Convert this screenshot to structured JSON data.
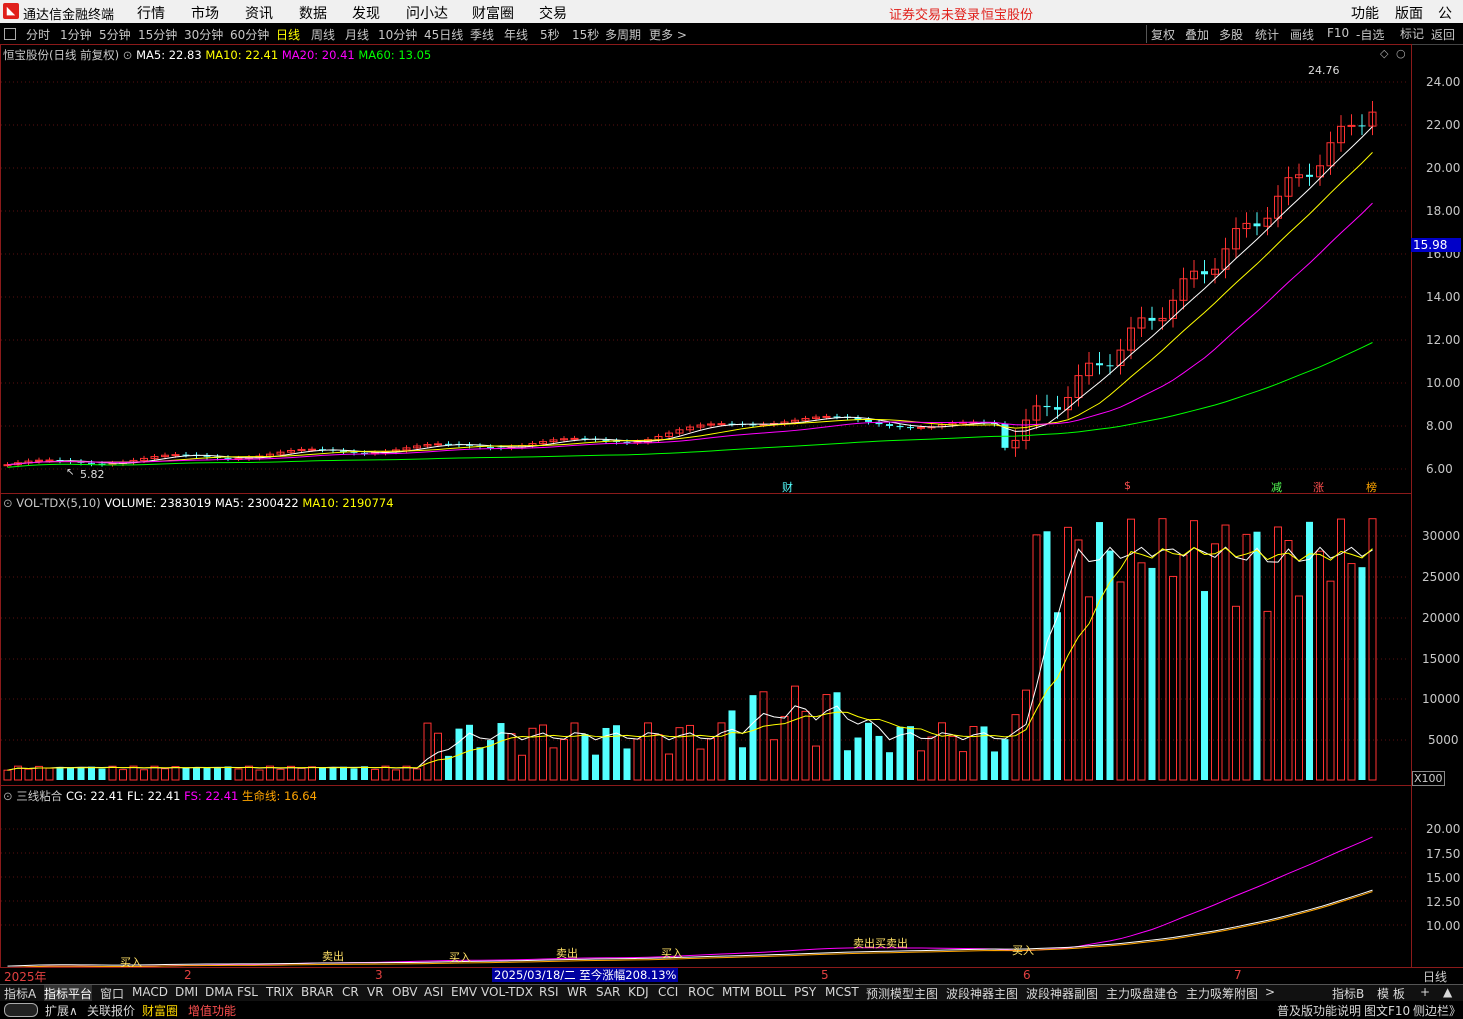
{
  "app": {
    "title": "通达信金融终端",
    "logo_icon": "tdx-logo-icon",
    "warn_login": "证券交易未登录",
    "warn_stock": "恒宝股份"
  },
  "menu": [
    "行情",
    "市场",
    "资讯",
    "数据",
    "发现",
    "问小达",
    "财富圈",
    "交易"
  ],
  "title_right": [
    "功能",
    "版面",
    "公式"
  ],
  "periods": [
    "分时",
    "1分钟",
    "5分钟",
    "15分钟",
    "30分钟",
    "60分钟",
    "日线",
    "周线",
    "月线",
    "10分钟",
    "45日线",
    "季线",
    "年线",
    "5秒",
    "15秒",
    "多周期",
    "更多 >"
  ],
  "active_period": "日线",
  "right_tools": [
    "复权",
    "叠加",
    "多股",
    "统计",
    "画线",
    "F10",
    "-自选",
    "返回"
  ],
  "main": {
    "stock": "恒宝股份(日线 前复权)",
    "ma5": "MA5: 22.83",
    "ma10": "MA10: 22.41",
    "ma20": "MA20: 20.41",
    "ma60": "MA60: 13.05",
    "high_label": "24.76",
    "low_label": "5.82",
    "current_price": "15.98",
    "y_labels": [
      "24.00",
      "22.00",
      "20.00",
      "18.00",
      "16.00",
      "14.00",
      "12.00",
      "10.00",
      "8.00",
      "6.00"
    ],
    "markers": [
      "财",
      "$",
      "减",
      "涨",
      "榜"
    ]
  },
  "volume": {
    "title": "VOL-TDX(5,10)",
    "volume": "VOLUME: 2383019",
    "ma5": "MA5: 2300422",
    "ma10": "MA10: 2190774",
    "y_labels": [
      "30000",
      "25000",
      "20000",
      "15000",
      "10000",
      "5000"
    ],
    "unit": "X100"
  },
  "indicator": {
    "title": "三线粘合",
    "cg": "CG: 22.41",
    "fl": "FL: 22.41",
    "fs": "FS: 22.41",
    "life": "生命线: 16.64",
    "y_labels": [
      "20.00",
      "17.50",
      "15.00",
      "12.50",
      "10.00"
    ],
    "signals": [
      "买入",
      "卖出",
      "买入",
      "卖出",
      "买入",
      "卖出买卖出",
      "买入"
    ]
  },
  "xaxis": {
    "labels": [
      "2025年",
      "2",
      "3",
      "5",
      "6",
      "7"
    ],
    "tooltip": "2025/03/18/二  至今涨幅208.13%",
    "right": "日线"
  },
  "bottom_tabs": [
    "指标A",
    "指标平台",
    "窗口",
    "MACD",
    "DMI",
    "DMA",
    "FSL",
    "TRIX",
    "BRAR",
    "CR",
    "VR",
    "OBV",
    "ASI",
    "EMV",
    "VOL-TDX",
    "RSI",
    "WR",
    "SAR",
    "KDJ",
    "CCI",
    "ROC",
    "MTM",
    "BOLL",
    "PSY",
    "MCST",
    "预测模型主图",
    "波段神器主图",
    "波段神器副图",
    "主力吸盘建仓",
    "主力吸筹附图"
  ],
  "bottom_right": [
    "指标B",
    "模 板",
    "+",
    "▲"
  ],
  "bottom2": [
    "扩展∧",
    "关联报价",
    "财富圈",
    "增值功能"
  ],
  "bottom2_right": [
    "普及版功能说明",
    "图文F10",
    "侧边栏》"
  ],
  "colors": {
    "up": "#ff3232",
    "down": "#54ffff",
    "ma5": "#ffffff",
    "ma10": "#ffff00",
    "ma20": "#ff00ff",
    "ma60": "#00ff00"
  }
}
